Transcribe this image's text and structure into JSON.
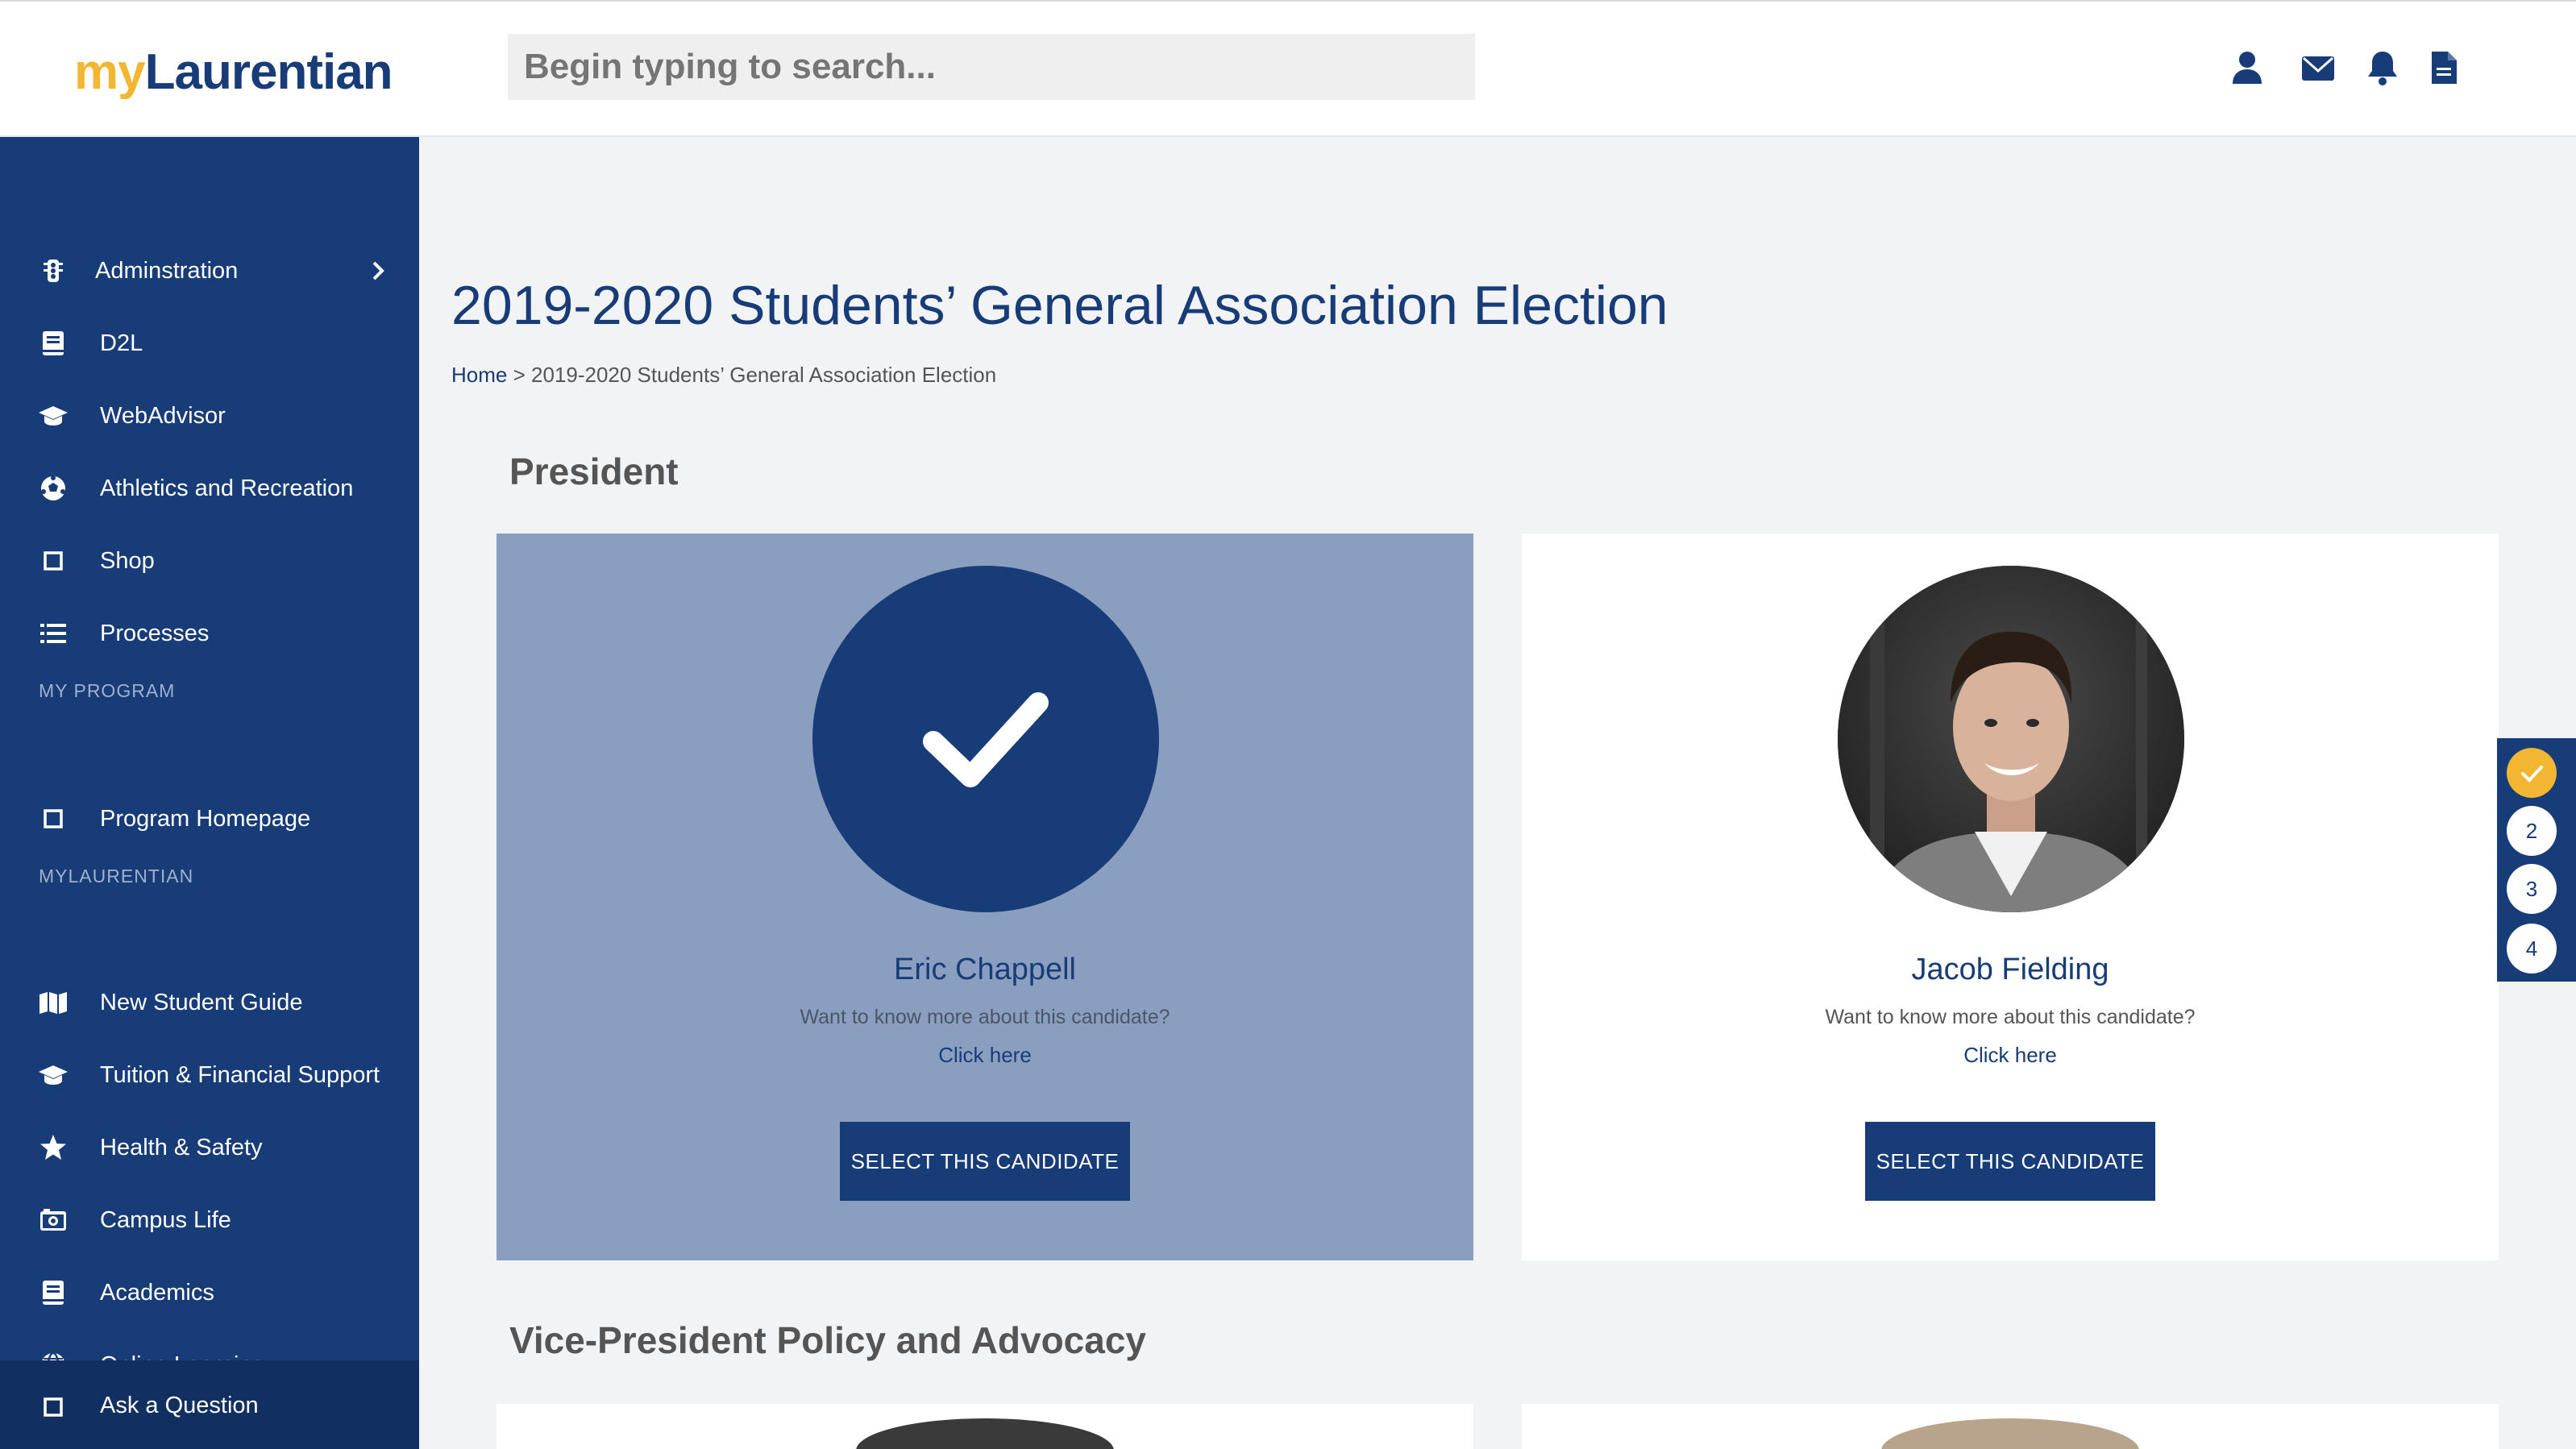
{
  "header": {
    "logo_my": "my",
    "logo_brand": "Laurentian",
    "search_placeholder": "Begin typing to search...",
    "icons": [
      "user-icon",
      "mail-icon",
      "bell-icon",
      "document-icon"
    ]
  },
  "sidebar": {
    "items": [
      {
        "label": "Adminstration",
        "icon": "traffic-light-icon",
        "has_chevron": true
      },
      {
        "label": "D2L",
        "icon": "book-icon"
      },
      {
        "label": "WebAdvisor",
        "icon": "graduation-cap-icon"
      },
      {
        "label": "Athletics and Recreation",
        "icon": "soccer-ball-icon"
      },
      {
        "label": "Shop",
        "icon": "square-icon"
      },
      {
        "label": "Processes",
        "icon": "list-icon"
      }
    ],
    "section_program": "MY PROGRAM",
    "program_items": [
      {
        "label": "Program Homepage",
        "icon": "square-icon"
      }
    ],
    "section_mylaurentian": "MYLAURENTIAN",
    "mylaurentian_items": [
      {
        "label": "New Student Guide",
        "icon": "map-icon"
      },
      {
        "label": "Tuition & Financial Support",
        "icon": "graduation-cap-icon"
      },
      {
        "label": "Health & Safety",
        "icon": "star-icon"
      },
      {
        "label": "Campus Life",
        "icon": "camera-icon"
      },
      {
        "label": "Academics",
        "icon": "book-icon"
      },
      {
        "label": "Online Learning",
        "icon": "globe-icon"
      }
    ],
    "ask": {
      "label": "Ask a Question",
      "icon": "square-icon"
    }
  },
  "main": {
    "title": "2019-2020 Students’ General Association Election",
    "breadcrumb_home": "Home",
    "breadcrumb_sep": " > ",
    "breadcrumb_current": "2019-2020 Students’ General Association Election",
    "sections": [
      {
        "title": "President",
        "candidates": [
          {
            "name": "Eric Chappell",
            "question": "Want to know more about this candidate?",
            "link": "Click here",
            "button": "SELECT THIS CANDIDATE",
            "selected": true
          },
          {
            "name": "Jacob Fielding",
            "question": "Want to know more about this candidate?",
            "link": "Click here",
            "button": "SELECT THIS CANDIDATE",
            "selected": false
          }
        ]
      },
      {
        "title": "Vice-President Policy and Advocacy"
      }
    ]
  },
  "steps": {
    "items": [
      "✓",
      "2",
      "3",
      "4"
    ],
    "completed": 1
  },
  "colors": {
    "primary": "#173c78",
    "accent": "#f2b632",
    "selected_card": "#8a9fbf",
    "background": "#f2f3f5"
  }
}
